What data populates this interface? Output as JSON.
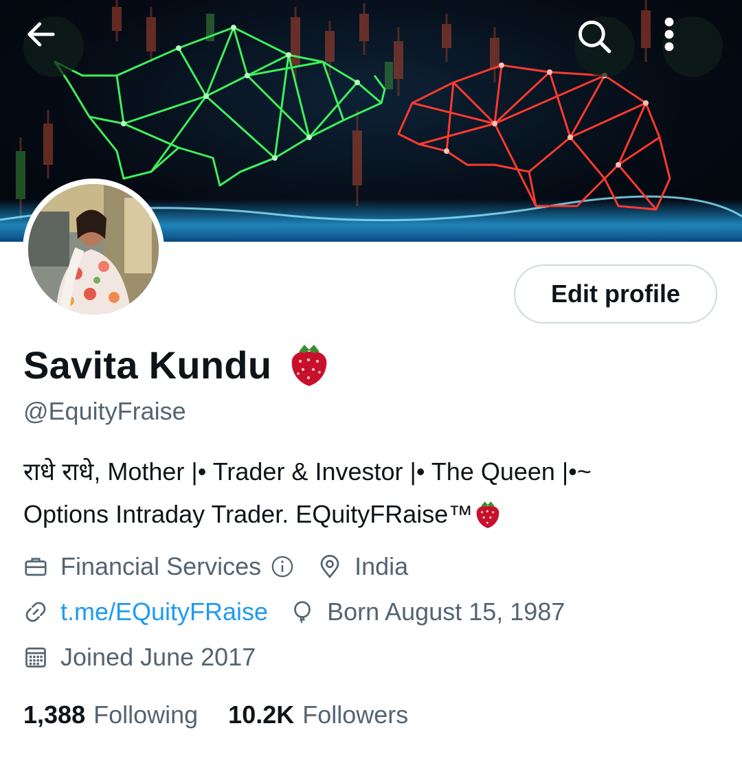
{
  "header": {
    "back_icon": "arrow-left-icon",
    "search_icon": "search-icon",
    "more_icon": "more-vertical-icon"
  },
  "profile": {
    "edit_button_label": "Edit profile",
    "name": "Savita Kundu",
    "name_emoji": "strawberry",
    "handle": "@EquityFraise",
    "bio_line1": "राधे राधे, Mother |• Trader & Investor |• The Queen |•~",
    "bio_line2": "Options Intraday Trader. EQuityFRaise™",
    "bio_emoji": "strawberry"
  },
  "meta": {
    "category": "Financial Services",
    "location": "India",
    "website": "t.me/EQuityFRaise",
    "birthday": "Born August 15, 1987",
    "joined": "Joined June 2017"
  },
  "stats": {
    "following_count": "1,388",
    "following_label": "Following",
    "followers_count": "10.2K",
    "followers_label": "Followers"
  },
  "colors": {
    "link": "#1d9bf0",
    "secondary_text": "#536471",
    "primary_text": "#0f1419",
    "bull": "#39e05a",
    "bear": "#ff3b30"
  }
}
